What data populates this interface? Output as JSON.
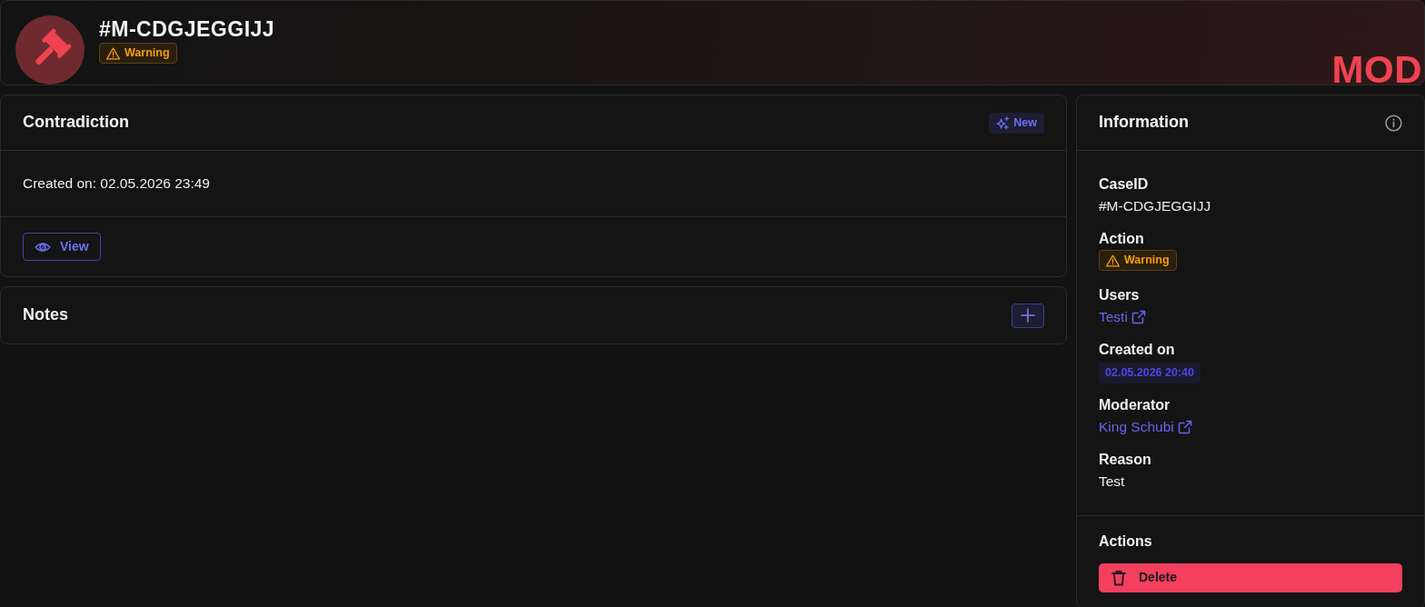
{
  "header": {
    "case_id": "#M-CDGJEGGIJJ",
    "badge": {
      "label": "Warning",
      "kind": "warning"
    },
    "corner_label": "MOD"
  },
  "contradiction": {
    "title": "Contradiction",
    "badge": "New",
    "created": "Created on: 02.05.2026 23:49",
    "button": "View"
  },
  "notes": {
    "title": "Notes"
  },
  "information": {
    "title": "Information",
    "fields": [
      {
        "label": "CaseID",
        "kind": "text",
        "value": "#M-CDGJEGGIJJ"
      },
      {
        "label": "Action",
        "kind": "warning",
        "value": "Warning"
      },
      {
        "label": "Users",
        "kind": "link",
        "value": "Testi"
      },
      {
        "label": "Created on",
        "kind": "date",
        "value": "02.05.2026 20:40"
      },
      {
        "label": "Moderator",
        "kind": "link",
        "value": "King Schubi"
      },
      {
        "label": "Reason",
        "kind": "text",
        "value": "Test"
      }
    ],
    "actions_title": "Actions",
    "actions": [
      {
        "label": "Delete",
        "kind": "danger"
      }
    ]
  }
}
